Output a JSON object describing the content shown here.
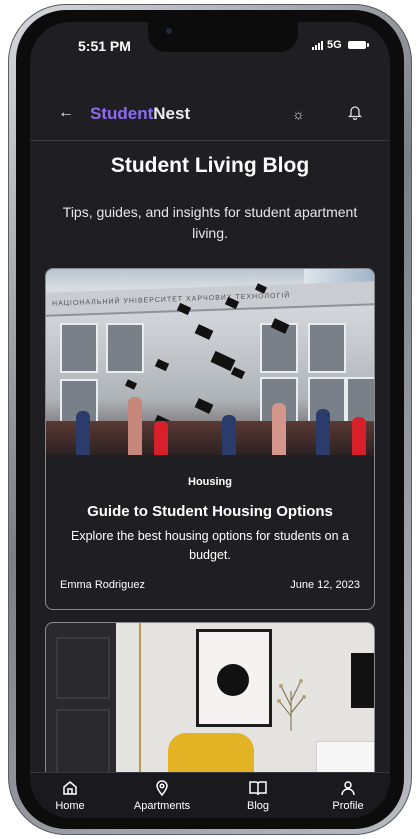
{
  "status": {
    "time": "5:51 PM",
    "network": "5G"
  },
  "header": {
    "brand_part1": "Student",
    "brand_part2": "Nest"
  },
  "hero": {
    "title": "Student Living Blog",
    "subtitle": "Tips, guides, and insights for student apartment living."
  },
  "posts": [
    {
      "category": "Housing",
      "title": "Guide to Student Housing Options",
      "description": "Explore the best housing options for students on a budget.",
      "author": "Emma Rodriguez",
      "date": "June 12, 2023",
      "image": "graduation-caps-thrown-in-front-of-university-building"
    },
    {
      "image": "modern-living-room-yellow-armchair"
    }
  ],
  "image_text": {
    "building_sign": "НАЦІОНАЛЬНИЙ УНІВЕРСИТЕТ ХАРЧОВИХ ТЕХНОЛОГІЙ"
  },
  "nav": [
    {
      "label": "Home",
      "icon": "home-icon"
    },
    {
      "label": "Apartments",
      "icon": "location-pin-icon"
    },
    {
      "label": "Blog",
      "icon": "book-open-icon"
    },
    {
      "label": "Profile",
      "icon": "user-icon"
    }
  ],
  "colors": {
    "accent": "#8b6cf0",
    "background": "#1f1e22",
    "text": "#ffffff"
  }
}
